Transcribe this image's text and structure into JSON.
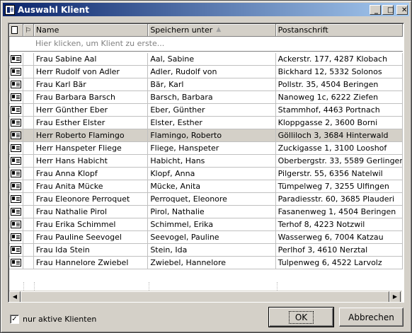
{
  "window": {
    "title": "Auswahl Klient",
    "buttons": {
      "minimize": "_",
      "maximize": "□",
      "close": "✕"
    }
  },
  "grid": {
    "columns": [
      "",
      "",
      "Name",
      "Speichern unter",
      "Postanschrift"
    ],
    "filter_placeholder": "Hier klicken, um Klient zu erste...",
    "rows": [
      {
        "name": "Frau Sabine Aal",
        "save_as": "Aal, Sabine",
        "address": "Ackerstr. 177, 4287  Klobach"
      },
      {
        "name": "Herr Rudolf von Adler",
        "save_as": "Adler, Rudolf von",
        "address": "Bickhard 12, 5332  Solonos"
      },
      {
        "name": "Frau Karl Bär",
        "save_as": "Bär, Karl",
        "address": "Pollstr. 35, 4504  Beringen"
      },
      {
        "name": "Frau Barbara Barsch",
        "save_as": "Barsch, Barbara",
        "address": "Nanoweg 1c, 6222  Ziefen"
      },
      {
        "name": "Herr Günther Eber",
        "save_as": "Eber, Günther",
        "address": "Stammhof, 4463  Portnach"
      },
      {
        "name": "Frau Esther Elster",
        "save_as": "Elster, Esther",
        "address": "Kloppgasse 2, 3600  Borni"
      },
      {
        "name": "Herr Roberto Flamingo",
        "save_as": "Flamingo, Roberto",
        "address": "Gölliloch 3, 3684  Hinterwald"
      },
      {
        "name": "Herr Hanspeter Fliege",
        "save_as": "Fliege, Hanspeter",
        "address": "Zuckigasse 1, 3100  Looshof"
      },
      {
        "name": "Herr Hans Habicht",
        "save_as": "Habicht, Hans",
        "address": "Oberbergstr. 33, 5589  Gerlingen"
      },
      {
        "name": "Frau Anna Klopf",
        "save_as": "Klopf, Anna",
        "address": "Pilgerstr. 55, 6356  Natelwil"
      },
      {
        "name": "Frau Anita Mücke",
        "save_as": "Mücke, Anita",
        "address": "Tümpelweg 7, 3255  Ulfingen"
      },
      {
        "name": "Frau Eleonore Perroquet",
        "save_as": "Perroquet, Eleonore",
        "address": "Paradiesstr. 60, 3685  Plauderi"
      },
      {
        "name": "Frau Nathalie Pirol",
        "save_as": "Pirol, Nathalie",
        "address": "Fasanenweg 1, 4504  Beringen"
      },
      {
        "name": "Frau Erika Schimmel",
        "save_as": "Schimmel, Erika",
        "address": "Terhof 8, 4223  Notzwil"
      },
      {
        "name": "Frau Pauline Seevogel",
        "save_as": "Seevogel, Pauline",
        "address": "Wasserweg 6, 7004  Katzau"
      },
      {
        "name": "Frau Ida Stein",
        "save_as": "Stein, Ida",
        "address": "Perlhof 3, 4610  Nerztal"
      },
      {
        "name": "Frau Hannelore Zwiebel",
        "save_as": "Zwiebel, Hannelore",
        "address": "Tulpenweg 6, 4522  Larvolz"
      }
    ],
    "selected_row": 6
  },
  "footer": {
    "checkbox_label": "nur aktive Klienten",
    "checkbox_checked": true,
    "ok_label": "OK",
    "cancel_label": "Abbrechen"
  },
  "colors": {
    "titlebar": "#0a246a",
    "face": "#d4d0c8"
  }
}
